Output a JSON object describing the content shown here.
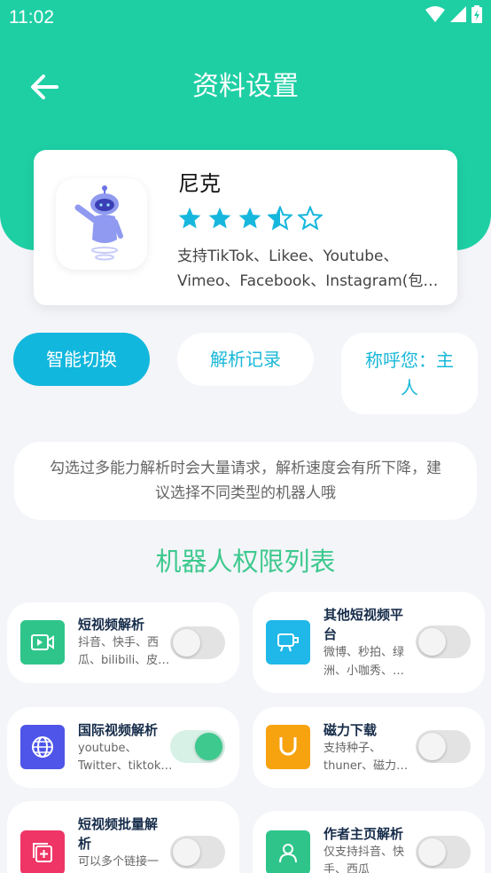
{
  "status_bar": {
    "time": "11:02"
  },
  "header": {
    "title": "资料设置"
  },
  "profile": {
    "name": "尼克",
    "rating": 3.5,
    "rating_max": 5,
    "description_line1": "支持TikTok、Likee、Youtube、",
    "description_line2": "Vimeo、Facebook、Instagram(包…"
  },
  "pills": {
    "smart_switch": "智能切换",
    "parse_history": "解析记录",
    "greeting_line1": "称呼您：主",
    "greeting_line2": "人"
  },
  "notice": {
    "line1": "勾选过多能力解析时会大量请求，解析速度会有所下降，建",
    "line2": "议选择不同类型的机器人哦"
  },
  "section_title": "机器人权限列表",
  "permissions": [
    {
      "title1": "短视频解析",
      "title2": "",
      "desc1": "抖音、快手、西",
      "desc2": "瓜、bilibili、皮…",
      "enabled": false,
      "icon": "video-play-icon",
      "color": "#2fc58a"
    },
    {
      "title1": "其他短视频平",
      "title2": "台",
      "desc1": "微博、秒拍、绿",
      "desc2": "洲、小咖秀、…",
      "enabled": false,
      "icon": "camera-icon",
      "color": "#1fb8e8"
    },
    {
      "title1": "国际视频解析",
      "title2": "",
      "desc1": "youtube、",
      "desc2": "Twitter、tiktok…",
      "enabled": true,
      "icon": "globe-icon",
      "color": "#4e55e8"
    },
    {
      "title1": "磁力下载",
      "title2": "",
      "desc1": "支持种子、",
      "desc2": "thuner、磁力链…",
      "enabled": false,
      "icon": "magnet-icon",
      "color": "#f7a20f"
    },
    {
      "title1": "短视频批量解",
      "title2": "析",
      "desc1": "可以多个链接一",
      "desc2": "",
      "enabled": false,
      "icon": "batch-add-icon",
      "color": "#ee3566"
    },
    {
      "title1": "作者主页解析",
      "title2": "",
      "desc1": "仅支持抖音、快",
      "desc2": "手、西瓜",
      "enabled": false,
      "icon": "user-icon",
      "color": "#2fc58a"
    }
  ]
}
